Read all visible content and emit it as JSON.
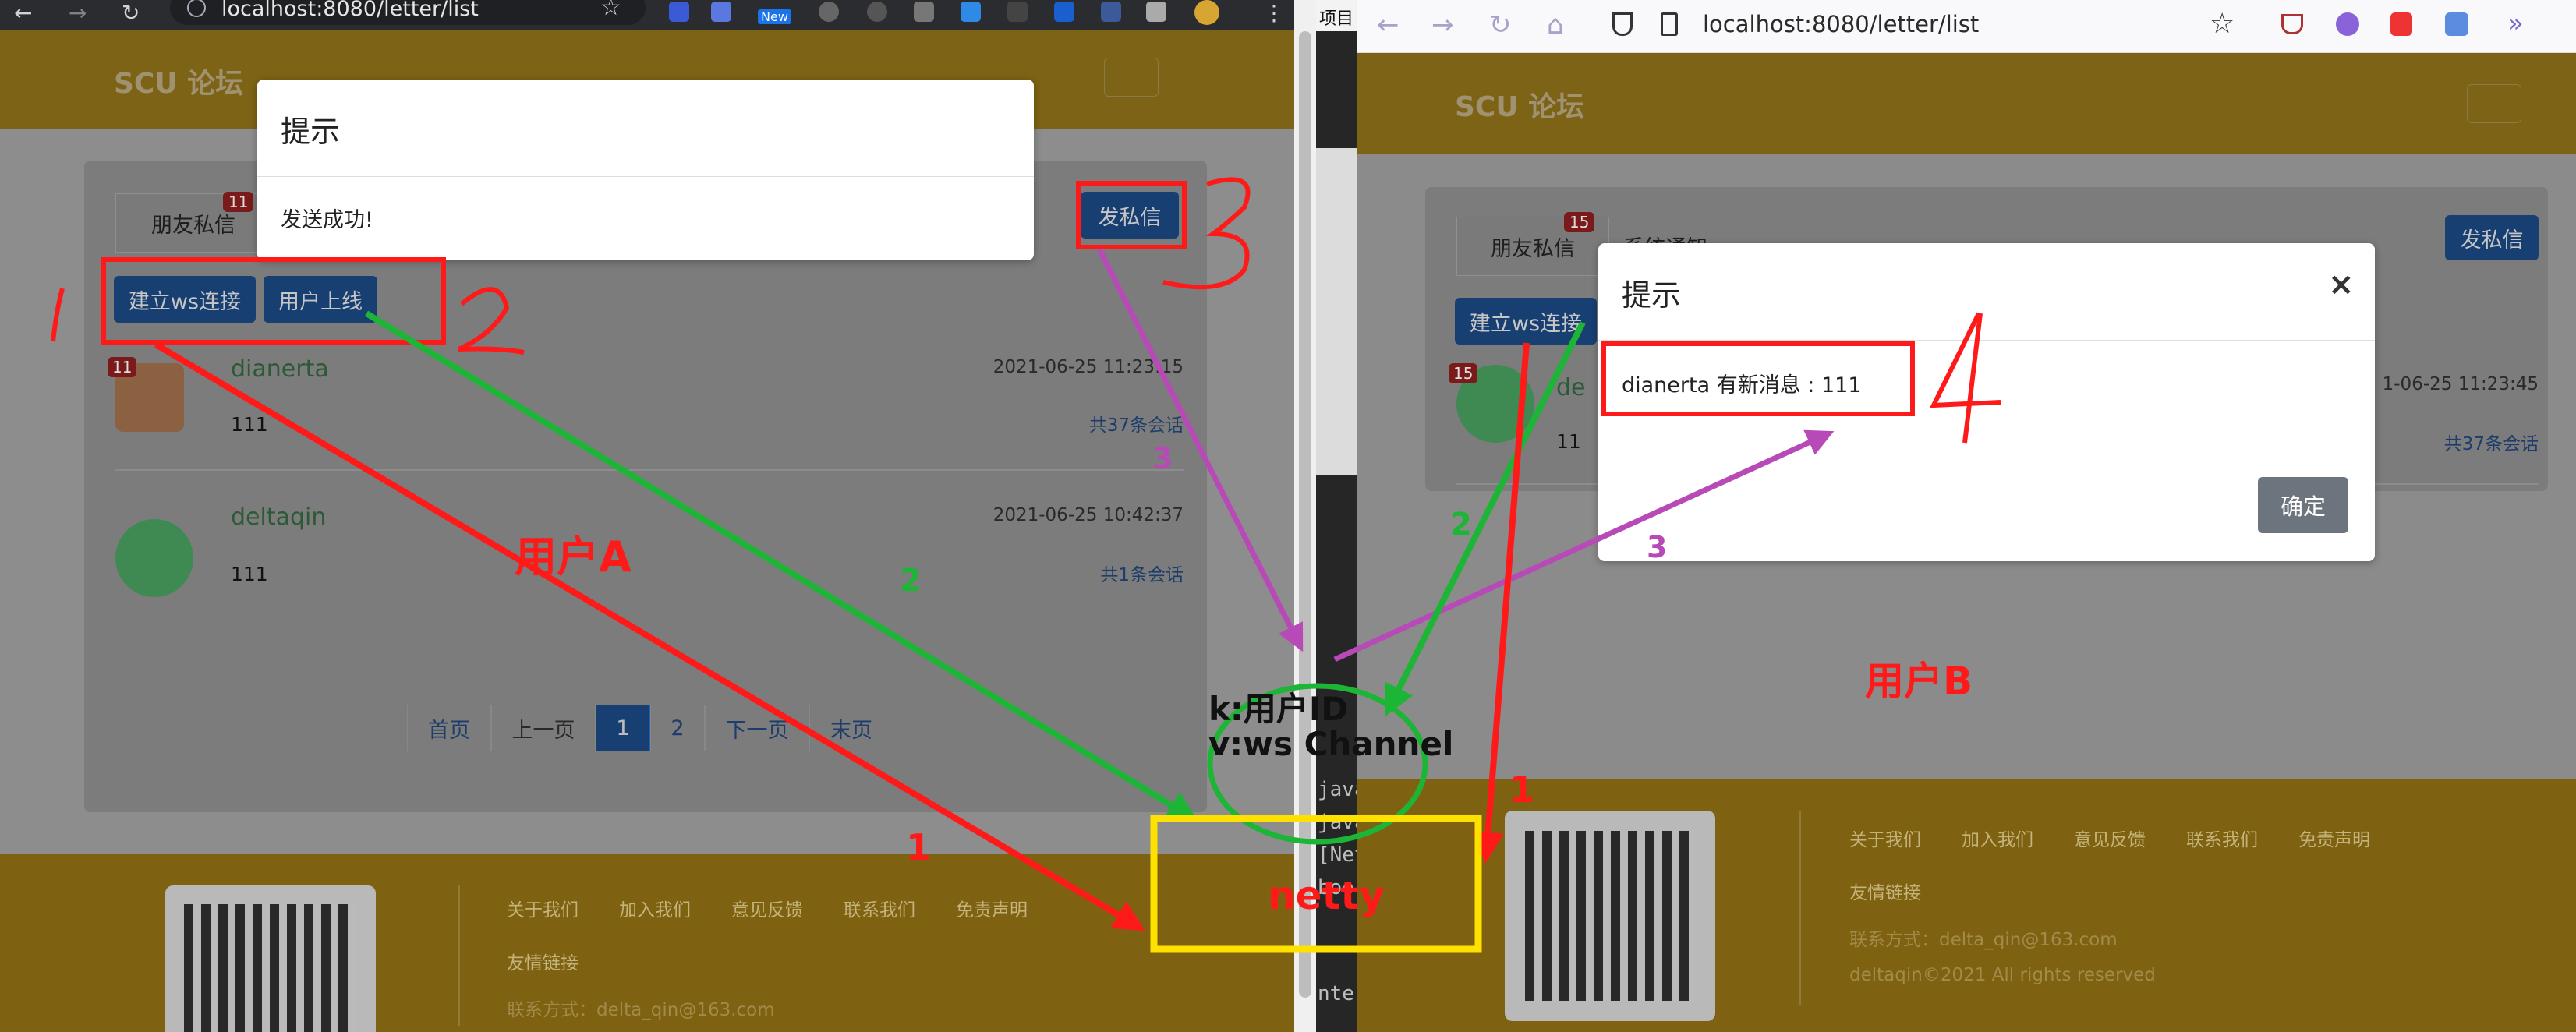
{
  "left_browser": {
    "url": "localhost:8080/letter/list",
    "badge_new": "New"
  },
  "right_browser": {
    "url": "localhost:8080/letter/list"
  },
  "bookmarks_fragment": "项目",
  "left_app": {
    "brand": "SCU 论坛",
    "tab_friend": "朋友私信",
    "tab_friend_badge": "11",
    "btn_ws": "建立ws连接",
    "btn_online": "用户上线",
    "btn_send": "发私信",
    "modal_title": "提示",
    "modal_body": "发送成功!",
    "letters": [
      {
        "name": "dianerta",
        "time": "2021-06-25 11:23:15",
        "content": "111",
        "count": "共37条会话",
        "badge": "11"
      },
      {
        "name": "deltaqin",
        "time": "2021-06-25 10:42:37",
        "content": "111",
        "count": "共1条会话"
      }
    ],
    "pagination": [
      "首页",
      "上一页",
      "1",
      "2",
      "下一页",
      "末页"
    ],
    "footer_links": [
      "关于我们",
      "加入我们",
      "意见反馈",
      "联系我们",
      "免责声明"
    ],
    "friend_link": "友情链接",
    "contact": "联系方式：delta_qin@163.com"
  },
  "right_app": {
    "brand": "SCU 论坛",
    "tab_friend": "朋友私信",
    "tab_friend_badge": "15",
    "tab_system": "系统通知",
    "btn_ws": "建立ws连接",
    "btn_send": "发私信",
    "letter_name": "de",
    "letter_content": "11",
    "letter_time": "1-06-25 11:23:45",
    "letter_count": "共37条会话",
    "letter_badge": "15",
    "modal_title": "提示",
    "modal_close": "×",
    "modal_body": "dianerta 有新消息 : 111",
    "modal_ok": "确定",
    "footer_links": [
      "关于我们",
      "加入我们",
      "意见反馈",
      "联系我们",
      "免责声明"
    ],
    "friend_link": "友情链接",
    "contact": "联系方式：delta_qin@163.com",
    "copyright": "deltaqin©2021 All rights reserved"
  },
  "terminal": {
    "lines": [
      "java",
      "java",
      "[Net",
      "boo"
    ],
    "bottom": "nter"
  },
  "annotations": {
    "num1_left": "1",
    "num2": "2",
    "num3": "3",
    "num4": "4",
    "user_a": "用户A",
    "user_b": "用户B",
    "arrow_1": "1",
    "arrow_1_right": "1",
    "arrow_2": "2",
    "arrow_2_right": "2",
    "arrow_3_left": "3",
    "arrow_3_right": "3",
    "k_label": "k:用户ID",
    "v_label": "v:ws Channel",
    "netty": "netty"
  },
  "colors": {
    "header_yellow": "#e8a812",
    "footer_olive": "#8a6c12",
    "annot_red": "#ff1a1a",
    "annot_green": "#1db536",
    "annot_purple": "#b84ab8",
    "annot_yellow": "#ffe100",
    "primary_blue": "#1f62b3"
  }
}
